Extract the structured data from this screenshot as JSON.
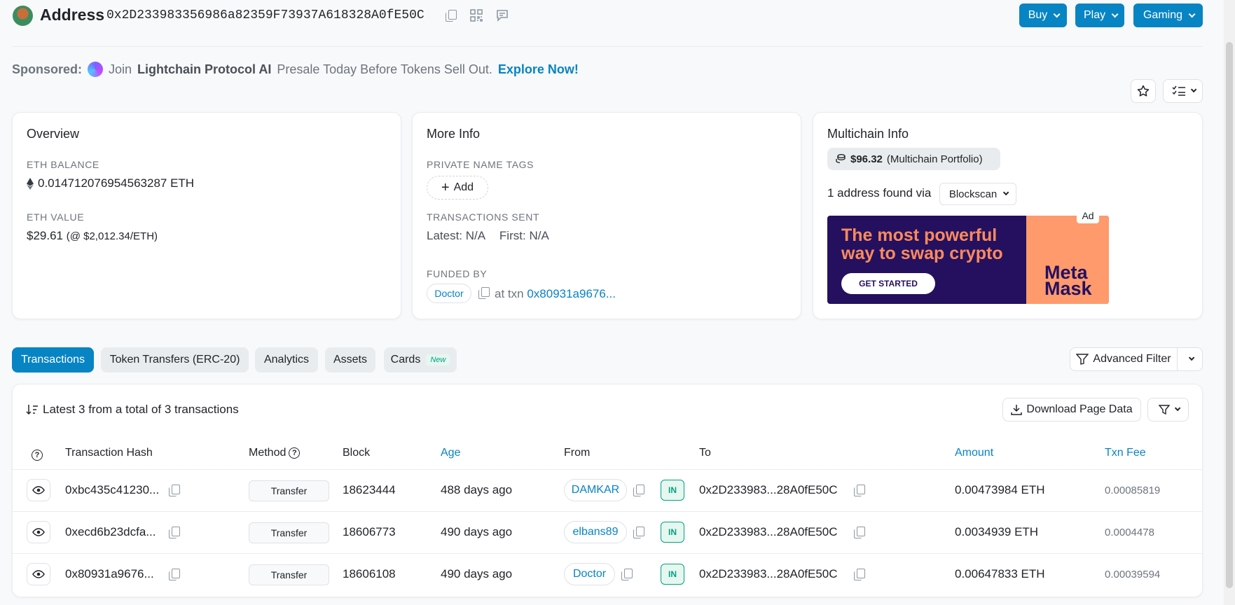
{
  "header": {
    "title": "Address",
    "address": "0x2D233983356986a82359F73937A618328A0fE50C",
    "buttons": {
      "buy": "Buy",
      "play": "Play",
      "gaming": "Gaming"
    }
  },
  "sponsored": {
    "label": "Sponsored:",
    "text_pre": "Join",
    "brand": "Lightchain Protocol AI",
    "text_post": "Presale Today Before Tokens Sell Out.",
    "link": "Explore Now!"
  },
  "overview": {
    "title": "Overview",
    "eth_balance_label": "ETH BALANCE",
    "eth_balance": "0.014712076954563287 ETH",
    "eth_value_label": "ETH VALUE",
    "eth_value": "$29.61",
    "eth_price": "(@ $2,012.34/ETH)"
  },
  "more_info": {
    "title": "More Info",
    "private_tags_label": "PRIVATE NAME TAGS",
    "add_label": "Add",
    "tx_sent_label": "TRANSACTIONS SENT",
    "latest_label": "Latest:",
    "latest_value": "N/A",
    "first_label": "First:",
    "first_value": "N/A",
    "funded_by_label": "FUNDED BY",
    "funded_by_tag": "Doctor",
    "at_txn_label": "at txn",
    "at_txn_hash": "0x80931a9676..."
  },
  "multichain": {
    "title": "Multichain Info",
    "portfolio_value": "$96.32",
    "portfolio_label": "(Multichain Portfolio)",
    "found_text": "1 address found via",
    "found_via": "Blockscan",
    "ad_label": "Ad",
    "ad_headline_1": "The most powerful",
    "ad_headline_2": "way to swap crypto",
    "ad_button": "GET STARTED",
    "ad_brand_1": "Meta",
    "ad_brand_2": "Mask"
  },
  "tabs": [
    {
      "label": "Transactions"
    },
    {
      "label": "Token Transfers (ERC-20)"
    },
    {
      "label": "Analytics"
    },
    {
      "label": "Assets"
    },
    {
      "label": "Cards",
      "badge": "New"
    }
  ],
  "advanced_filter": "Advanced Filter",
  "table": {
    "summary": "Latest 3 from a total of 3 transactions",
    "download": "Download Page Data",
    "headers": {
      "hash": "Transaction Hash",
      "method": "Method",
      "block": "Block",
      "age": "Age",
      "from": "From",
      "to": "To",
      "amount": "Amount",
      "fee": "Txn Fee"
    },
    "rows": [
      {
        "hash": "0xbc435c41230...",
        "method": "Transfer",
        "block": "18623444",
        "age": "488 days ago",
        "from": "DAMKAR",
        "direction": "IN",
        "to": "0x2D233983...28A0fE50C",
        "amount": "0.00473984 ETH",
        "fee": "0.00085819"
      },
      {
        "hash": "0xecd6b23dcfa...",
        "method": "Transfer",
        "block": "18606773",
        "age": "490 days ago",
        "from": "elbans89",
        "direction": "IN",
        "to": "0x2D233983...28A0fE50C",
        "amount": "0.0034939 ETH",
        "fee": "0.0004478"
      },
      {
        "hash": "0x80931a9676...",
        "method": "Transfer",
        "block": "18606108",
        "age": "490 days ago",
        "from": "Doctor",
        "direction": "IN",
        "to": "0x2D233983...28A0fE50C",
        "amount": "0.00647833 ETH",
        "fee": "0.00039594"
      }
    ]
  },
  "colors": {
    "accent": "#0784c3",
    "in_badge": "#00a186"
  }
}
